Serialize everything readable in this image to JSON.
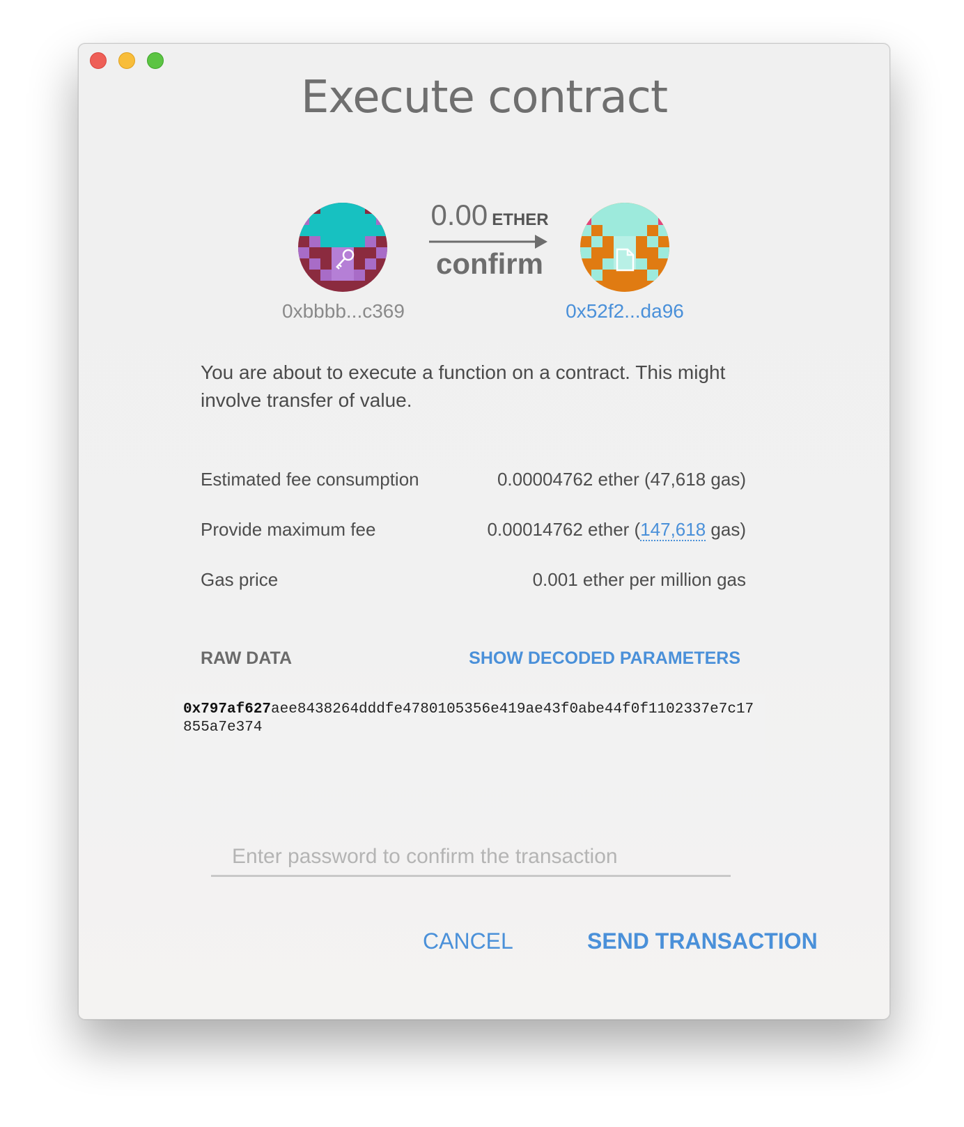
{
  "title": "Execute contract",
  "from": {
    "address": "0xbbbb...c369",
    "icon": "key-icon"
  },
  "to": {
    "address": "0x52f2...da96",
    "icon": "file-icon"
  },
  "amount": {
    "value": "0.00",
    "unit": "ETHER",
    "action": "confirm"
  },
  "description": "You are about to execute a function on a contract. This might involve transfer of value.",
  "fees": {
    "estimated": {
      "label": "Estimated fee consumption",
      "value": "0.00004762 ether (47,618 gas)"
    },
    "maximum": {
      "label": "Provide maximum fee",
      "value_prefix": "0.00014762 ether (",
      "gas_link": "147,618",
      "value_suffix": " gas)"
    },
    "gas_price": {
      "label": "Gas price",
      "value": "0.001 ether per million gas"
    }
  },
  "raw_data": {
    "label": "RAW DATA",
    "toggle_label": "SHOW DECODED PARAMETERS",
    "method_id": "0x797af627",
    "payload": "aee8438264dddfe4780105356e419ae43f0abe44f0f1102337e7c17855a7e374"
  },
  "password": {
    "placeholder": "Enter password to confirm the transaction",
    "value": ""
  },
  "buttons": {
    "cancel": "CANCEL",
    "send": "SEND TRANSACTION"
  },
  "colors": {
    "accent": "#4a90d9",
    "text": "#4a4a4a",
    "from_identicon": [
      "#17c1c1",
      "#a86cc7",
      "#8b2b3f"
    ],
    "to_identicon": [
      "#e07b12",
      "#9deadc",
      "#e2457a"
    ]
  }
}
